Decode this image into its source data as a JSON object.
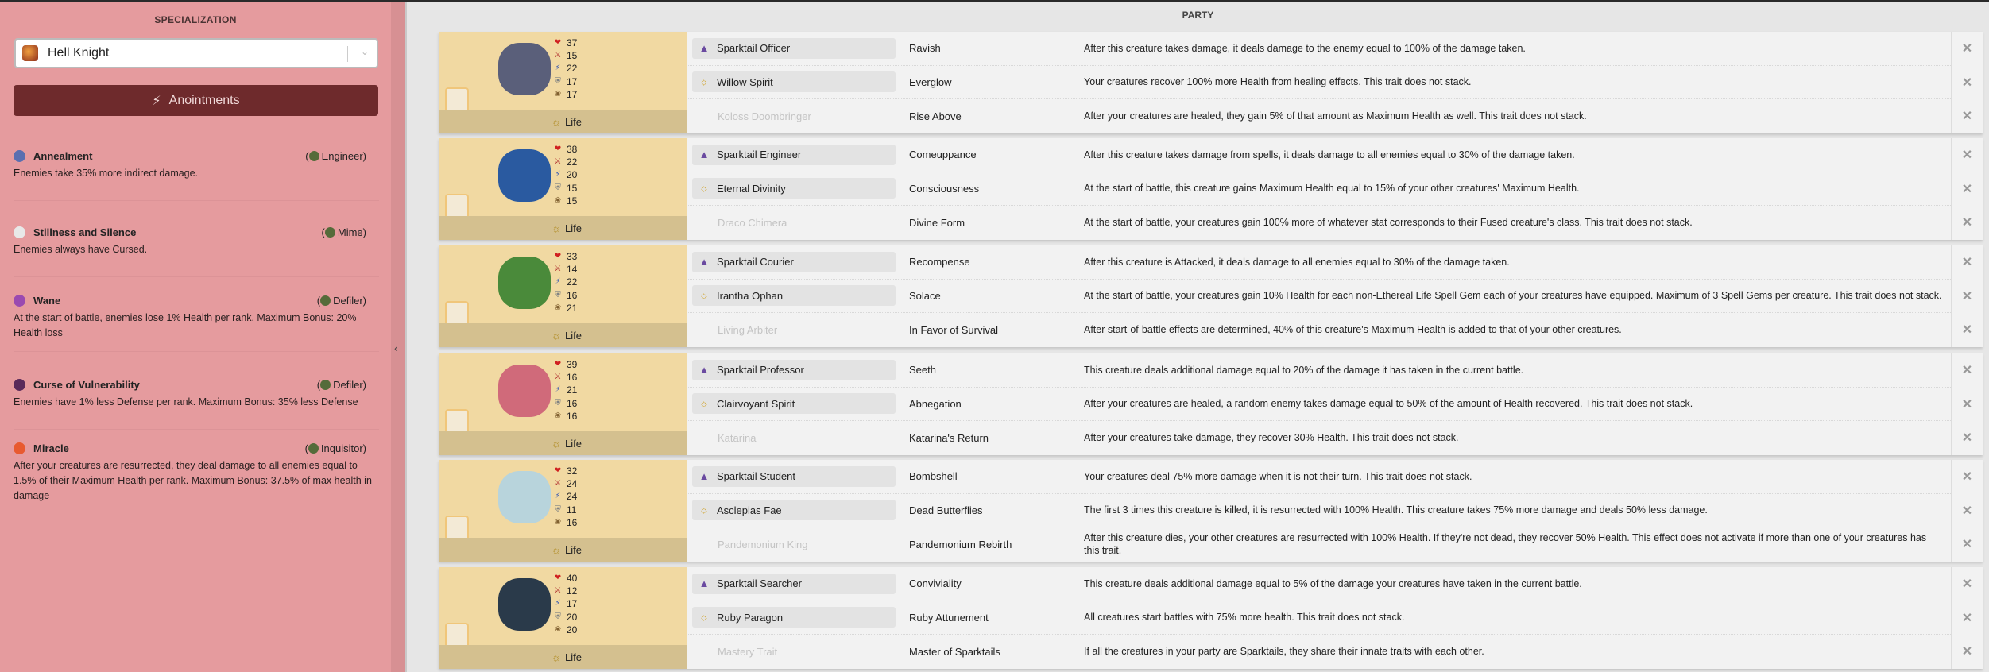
{
  "sidebar": {
    "title": "SPECIALIZATION",
    "specialization": "Hell Knight",
    "anointments_label": "Anointments",
    "collapse_icon": "chevron-left-icon",
    "specs": [
      {
        "name": "Annealment",
        "class": "Engineer",
        "description": "Enemies take 35% more indirect damage.",
        "color": "#5a6fb0"
      },
      {
        "name": "Stillness and Silence",
        "class": "Mime",
        "description": "Enemies always have Cursed.",
        "color": "#e8e8e8"
      },
      {
        "name": "Wane",
        "class": "Defiler",
        "description": "At the start of battle, enemies lose 1% Health per rank. Maximum Bonus: 20% Health loss",
        "color": "#9a4ab0"
      },
      {
        "name": "Curse of Vulnerability",
        "class": "Defiler",
        "description": "Enemies have 1% less Defense per rank. Maximum Bonus: 35% less Defense",
        "color": "#5a2a5a"
      },
      {
        "name": "Miracle",
        "class": "Inquisitor",
        "description": "After your creatures are resurrected, they deal damage to all enemies equal to 1.5% of their Maximum Health per rank. Maximum Bonus: 37.5% of max health in damage",
        "color": "#e85a30"
      }
    ]
  },
  "party": {
    "title": "PARTY",
    "colors": {
      "panel": "#f1d9a2",
      "sidebar": "#e59b9e",
      "button": "#6e2a2c"
    },
    "creatures": [
      {
        "stats": [
          "37",
          "15",
          "22",
          "17",
          "17"
        ],
        "element": "Life",
        "sprite_color": "#5a5f7a",
        "traits": [
          {
            "source": "Sparktail Officer",
            "name": "Ravish",
            "description": "After this creature takes damage, it deals damage to the enemy equal to 100% of the damage taken."
          },
          {
            "source": "Willow Spirit",
            "name": "Everglow",
            "description": "Your creatures recover 100% more Health from healing effects. This trait does not stack."
          },
          {
            "source": "Koloss Doombringer",
            "name": "Rise Above",
            "description": "After your creatures are healed, they gain 5% of that amount as Maximum Health as well. This trait does not stack."
          }
        ]
      },
      {
        "stats": [
          "38",
          "22",
          "20",
          "15",
          "15"
        ],
        "element": "Life",
        "sprite_color": "#2a5aa0",
        "traits": [
          {
            "source": "Sparktail Engineer",
            "name": "Comeuppance",
            "description": "After this creature takes damage from spells, it deals damage to all enemies equal to 30% of the damage taken."
          },
          {
            "source": "Eternal Divinity",
            "name": "Consciousness",
            "description": "At the start of battle, this creature gains Maximum Health equal to 15% of your other creatures' Maximum Health."
          },
          {
            "source": "Draco Chimera",
            "name": "Divine Form",
            "description": "At the start of battle, your creatures gain 100% more of whatever stat corresponds to their Fused creature's class. This trait does not stack."
          }
        ]
      },
      {
        "stats": [
          "33",
          "14",
          "22",
          "16",
          "21"
        ],
        "element": "Life",
        "sprite_color": "#4a8a3a",
        "traits": [
          {
            "source": "Sparktail Courier",
            "name": "Recompense",
            "description": "After this creature is Attacked, it deals damage to all enemies equal to 30% of the damage taken."
          },
          {
            "source": "Irantha Ophan",
            "name": "Solace",
            "description": "At the start of battle, your creatures gain 10% Health for each non-Ethereal Life Spell Gem each of your creatures have equipped. Maximum of 3 Spell Gems per creature. This trait does not stack."
          },
          {
            "source": "Living Arbiter",
            "name": "In Favor of Survival",
            "description": "After start-of-battle effects are determined, 40% of this creature's Maximum Health is added to that of your other creatures."
          }
        ]
      },
      {
        "stats": [
          "39",
          "16",
          "21",
          "16",
          "16"
        ],
        "element": "Life",
        "sprite_color": "#d06a7a",
        "traits": [
          {
            "source": "Sparktail Professor",
            "name": "Seeth",
            "description": "This creature deals additional damage equal to 20% of the damage it has taken in the current battle."
          },
          {
            "source": "Clairvoyant Spirit",
            "name": "Abnegation",
            "description": "After your creatures are healed, a random enemy takes damage equal to 50% of the amount of Health recovered. This trait does not stack."
          },
          {
            "source": "Katarina",
            "name": "Katarina's Return",
            "description": "After your creatures take damage, they recover 30% Health. This trait does not stack."
          }
        ]
      },
      {
        "stats": [
          "32",
          "24",
          "24",
          "11",
          "16"
        ],
        "element": "Life",
        "sprite_color": "#b8d4dc",
        "traits": [
          {
            "source": "Sparktail Student",
            "name": "Bombshell",
            "description": "Your creatures deal 75% more damage when it is not their turn. This trait does not stack."
          },
          {
            "source": "Asclepias Fae",
            "name": "Dead Butterflies",
            "description": "The first 3 times this creature is killed, it is resurrected with 100% Health. This creature takes 75% more damage and deals 50% less damage."
          },
          {
            "source": "Pandemonium King",
            "name": "Pandemonium Rebirth",
            "description": "After this creature dies, your other creatures are resurrected with 100% Health. If they're not dead, they recover 50% Health. This effect does not activate if more than one of your creatures has this trait."
          }
        ]
      },
      {
        "stats": [
          "40",
          "12",
          "17",
          "20",
          "20"
        ],
        "element": "Life",
        "sprite_color": "#2a3a4a",
        "traits": [
          {
            "source": "Sparktail Searcher",
            "name": "Conviviality",
            "description": "This creature deals additional damage equal to 5% of the damage your creatures have taken in the current battle."
          },
          {
            "source": "Ruby Paragon",
            "name": "Ruby Attunement",
            "description": "All creatures start battles with 75% more health. This trait does not stack."
          },
          {
            "source": "Mastery Trait",
            "name": "Master of Sparktails",
            "description": "If all the creatures in your party are Sparktails, they share their innate traits with each other."
          }
        ]
      }
    ]
  }
}
